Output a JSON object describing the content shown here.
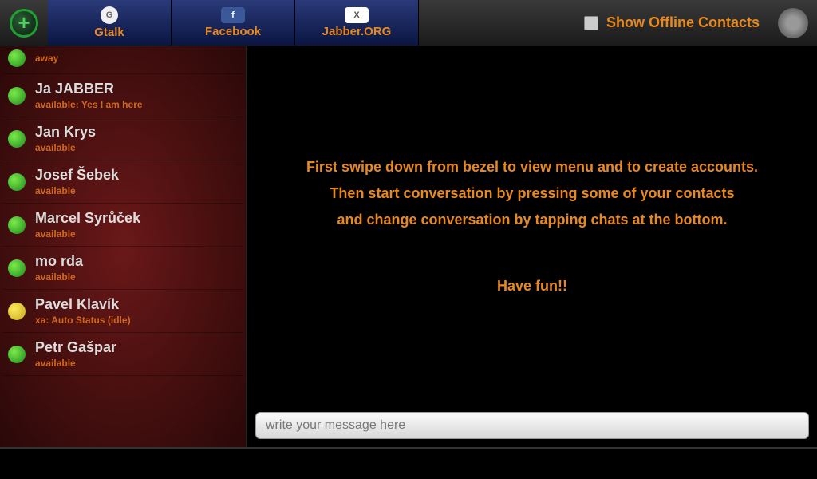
{
  "header": {
    "accounts": [
      {
        "label": "Gtalk",
        "iconClass": "gtalk",
        "iconText": "G"
      },
      {
        "label": "Facebook",
        "iconClass": "facebook",
        "iconText": "f"
      },
      {
        "label": "Jabber.ORG",
        "iconClass": "xmpp",
        "iconText": "X"
      }
    ],
    "showOffline": "Show Offline Contacts"
  },
  "contacts": [
    {
      "name": "",
      "status": "away",
      "presence": "green",
      "partial": true
    },
    {
      "name": "Ja JABBER",
      "status": "available: Yes I am here",
      "presence": "green"
    },
    {
      "name": "Jan Krys",
      "status": "available",
      "presence": "green"
    },
    {
      "name": "Josef Šebek",
      "status": "available",
      "presence": "green"
    },
    {
      "name": "Marcel Syrůček",
      "status": "available",
      "presence": "green"
    },
    {
      "name": "mo rda",
      "status": "available",
      "presence": "green"
    },
    {
      "name": "Pavel Klavík",
      "status": "xa: Auto Status (idle)",
      "presence": "yellow"
    },
    {
      "name": "Petr Gašpar",
      "status": "available",
      "presence": "green"
    }
  ],
  "welcome": {
    "line1": "First swipe down from bezel to view menu and to create accounts.",
    "line2": "Then start conversation by pressing some of your contacts",
    "line3": "and change conversation by tapping chats at the bottom.",
    "fun": "Have fun!!"
  },
  "input": {
    "placeholder": "write your message here"
  }
}
